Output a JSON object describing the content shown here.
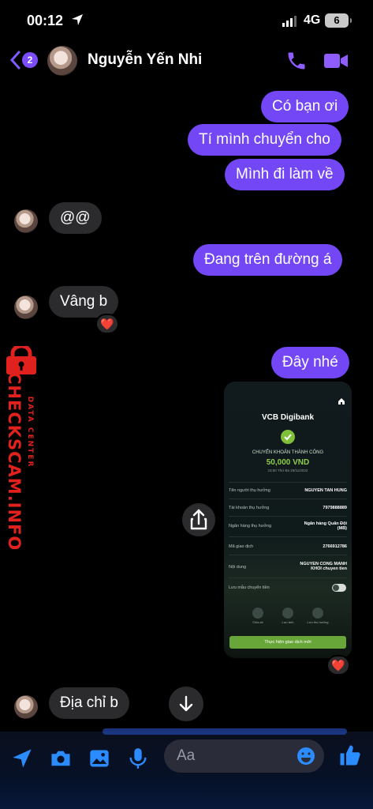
{
  "status": {
    "time": "00:12",
    "network": "4G",
    "battery": "6"
  },
  "header": {
    "back_count": "2",
    "contact_name": "Nguyễn Yến Nhi"
  },
  "messages": {
    "m1": "Có bạn ơi",
    "m2": "Tí mình chuyển cho",
    "m3": "Mình đi làm về",
    "m4": "@@",
    "m5": "Đang trên đường á",
    "m6": "Vâng b",
    "m7": "Đây nhé",
    "m8": "Địa chỉ b"
  },
  "reactions": {
    "r1": "❤️",
    "r2": "❤️"
  },
  "watermark": {
    "main": "CHECKSCAM.INFO",
    "sub": "DATA CENTER"
  },
  "receipt": {
    "brand": "VCB Digibank",
    "status": "CHUYỂN KHOẢN THÀNH CÔNG",
    "amount": "50,000 VND",
    "datetime": "23:50 Thứ Ba 29/11/2022",
    "rows": [
      {
        "label": "Tên người thụ hưởng",
        "value": "NGUYEN TAN HUNG"
      },
      {
        "label": "Tài khoản thụ hưởng",
        "value": "7979888889"
      },
      {
        "label": "Ngân hàng thụ hưởng",
        "value": "Ngân hàng Quân Đội (MB)"
      },
      {
        "label": "Mã giao dịch",
        "value": "2766912786"
      },
      {
        "label": "Nội dung",
        "value": "NGUYEN CONG MANH KHOI chuyen tien"
      }
    ],
    "save_label": "Lưu mẫu chuyển tiền",
    "actions": [
      "Chia sẻ",
      "Lưu ảnh",
      "Lưu thụ hưởng"
    ],
    "cta": "Thực hiện giao dịch mới"
  },
  "composer": {
    "placeholder": "Aa"
  }
}
